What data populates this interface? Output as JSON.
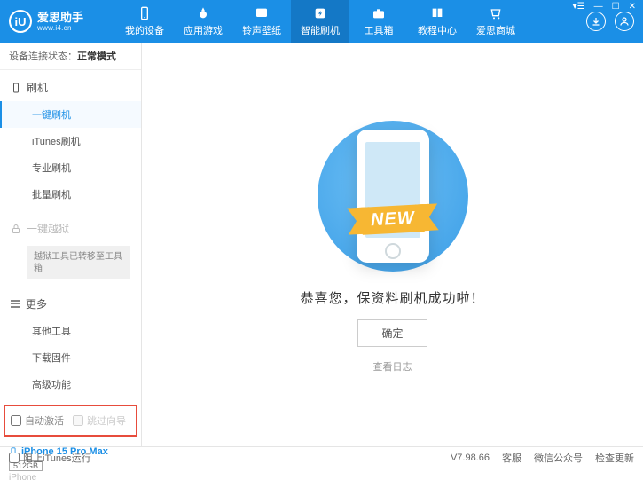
{
  "logo": {
    "mark": "iU",
    "title": "爱思助手",
    "subtitle": "www.i4.cn"
  },
  "nav": [
    {
      "label": "我的设备"
    },
    {
      "label": "应用游戏"
    },
    {
      "label": "铃声壁纸"
    },
    {
      "label": "智能刷机",
      "active": true
    },
    {
      "label": "工具箱"
    },
    {
      "label": "教程中心"
    },
    {
      "label": "爱思商城"
    }
  ],
  "status": {
    "prefix": "设备连接状态：",
    "value": "正常模式"
  },
  "sidebar": {
    "section1": {
      "title": "刷机",
      "items": [
        "一键刷机",
        "iTunes刷机",
        "专业刷机",
        "批量刷机"
      ]
    },
    "section2": {
      "title": "一键越狱",
      "boxed": "越狱工具已转移至工具箱"
    },
    "section3": {
      "title": "更多",
      "items": [
        "其他工具",
        "下载固件",
        "高级功能"
      ]
    }
  },
  "checks": {
    "auto_activate": "自动激活",
    "skip_guide": "跳过向导"
  },
  "device": {
    "name": "iPhone 15 Pro Max",
    "storage": "512GB",
    "type": "iPhone"
  },
  "main": {
    "ribbon": "NEW",
    "message": "恭喜您，保资料刷机成功啦！",
    "ok": "确定",
    "log": "查看日志"
  },
  "footer": {
    "block_itunes": "阻止iTunes运行",
    "version": "V7.98.66",
    "support": "客服",
    "wechat": "微信公众号",
    "update": "检查更新"
  }
}
